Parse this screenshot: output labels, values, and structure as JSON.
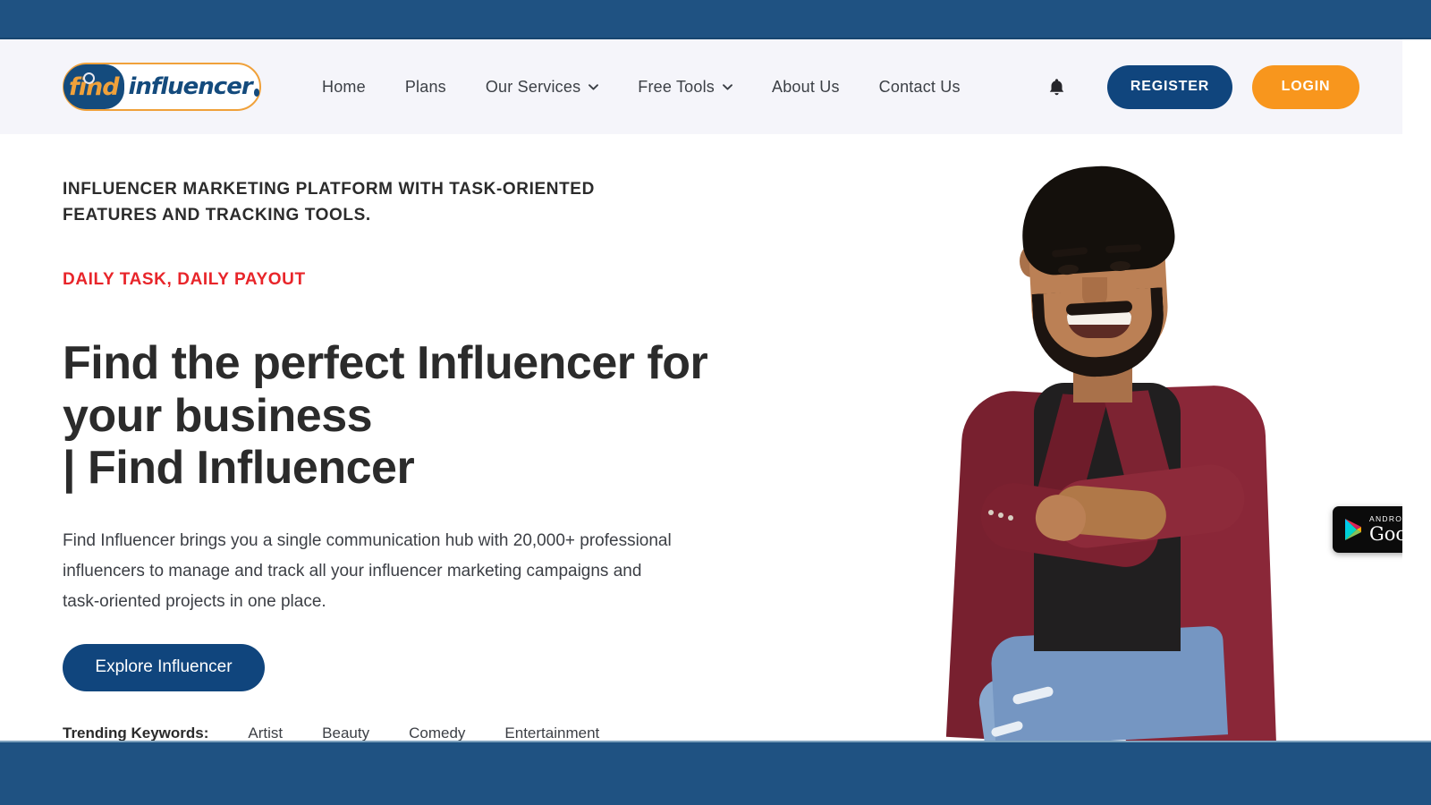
{
  "window": {
    "chrome_color": "#1f5282"
  },
  "header": {
    "background": "#f5f5fa",
    "logo": {
      "find_text": "find",
      "influencer_text": "influencer",
      "badge_color": "#144b7d",
      "accent_color": "#f0a13a"
    },
    "menu": [
      {
        "label": "Home",
        "has_caret": false
      },
      {
        "label": "Plans",
        "has_caret": false
      },
      {
        "label": "Our Services",
        "has_caret": true
      },
      {
        "label": "Free Tools",
        "has_caret": true
      },
      {
        "label": "About Us",
        "has_caret": false
      },
      {
        "label": "Contact Us",
        "has_caret": false
      }
    ],
    "notifications_icon": "bell-icon",
    "register_label": "REGISTER",
    "register_color": "#10457d",
    "login_label": "LOGIN",
    "login_color": "#f8961d"
  },
  "hero": {
    "eyebrow": "INFLUENCER MARKETING PLATFORM WITH TASK-ORIENTED FEATURES AND TRACKING TOOLS.",
    "tagline": "DAILY TASK, DAILY PAYOUT",
    "tagline_color": "#e8252a",
    "headline_line1": "Find the perfect Influencer for",
    "headline_line2": "your business",
    "headline_line3": "| Find Influencer",
    "blurb": "Find Influencer brings you a single communication hub with 20,000+ professional influencers to manage and track all your influencer marketing campaigns and task-oriented projects in one place.",
    "cta_label": "Explore Influencer",
    "trending_label": "Trending Keywords:",
    "keywords": [
      "Artist",
      "Beauty",
      "Comedy",
      "Entertainment"
    ],
    "image_alt": "smiling-man-in-maroon-blazer-seated-arms-crossed"
  },
  "play_badge": {
    "top_label": "ANDROID APP ON",
    "bottom_label": "Google Play",
    "icon": "google-play-triangle-icon"
  }
}
